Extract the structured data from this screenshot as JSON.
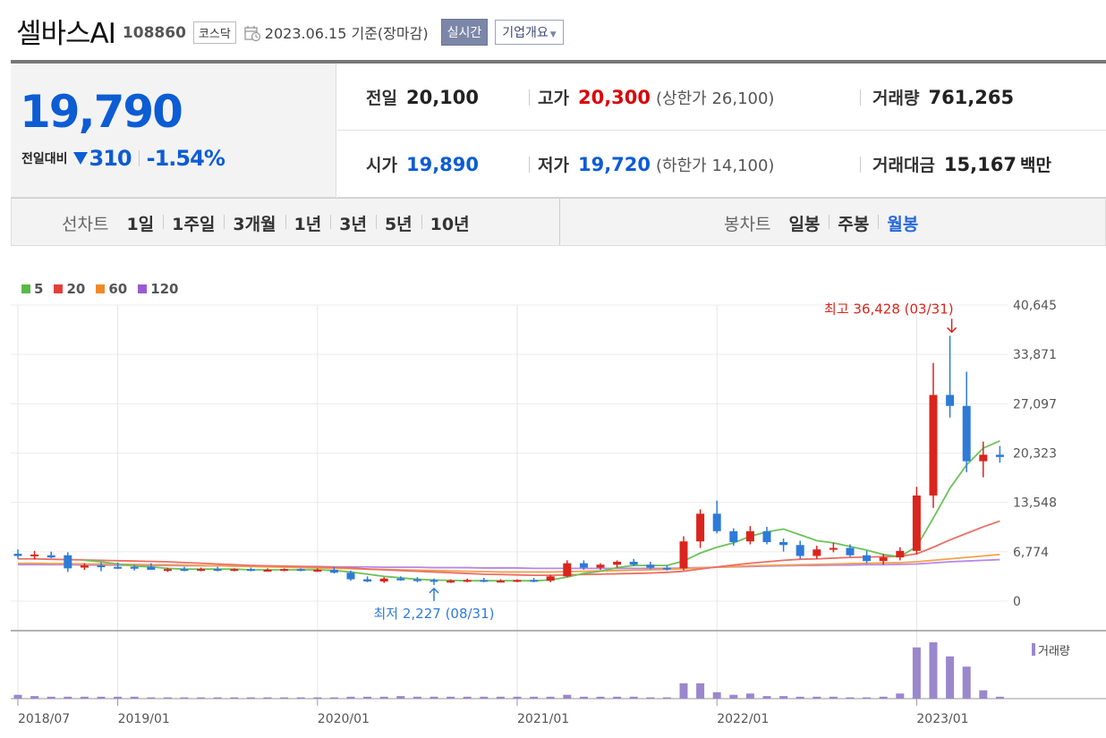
{
  "header": {
    "company_name": "셀바스AI",
    "code": "108860",
    "market": "코스닥",
    "date_text": "2023.06.15 기준(장마감)",
    "realtime_label": "실시간",
    "overview_label": "기업개요"
  },
  "price": {
    "current": "19,790",
    "change_label": "전일대비",
    "change_amount": "310",
    "change_pct": "-1.54%",
    "direction": "down"
  },
  "stats": {
    "prev_close": {
      "label": "전일",
      "value": "20,100"
    },
    "high": {
      "label": "고가",
      "value": "20,300",
      "limit_label": "(상한가 26,100)"
    },
    "volume": {
      "label": "거래량",
      "value": "761,265"
    },
    "open": {
      "label": "시가",
      "value": "19,890"
    },
    "low": {
      "label": "저가",
      "value": "19,720",
      "limit_label": "(하한가 14,100)"
    },
    "trade_value": {
      "label": "거래대금",
      "value": "15,167",
      "unit": "백만"
    }
  },
  "line_chart_tabs": {
    "label": "선차트",
    "items": [
      "1일",
      "1주일",
      "3개월",
      "1년",
      "3년",
      "5년",
      "10년"
    ]
  },
  "candle_chart_tabs": {
    "label": "봉차트",
    "items": [
      "일봉",
      "주봉",
      "월봉"
    ],
    "active": "월봉"
  },
  "legend": [
    {
      "label": "5",
      "color": "#58b847"
    },
    {
      "label": "20",
      "color": "#e0413a"
    },
    {
      "label": "60",
      "color": "#f08a24"
    },
    {
      "label": "120",
      "color": "#9a5bd1"
    }
  ],
  "colors": {
    "up": "#d9251d",
    "down": "#2f7ad8",
    "accent": "#0c5cd4"
  },
  "chart_data": {
    "type": "candlestick",
    "interval": "monthly",
    "y_ticks": [
      0,
      6774,
      13548,
      20323,
      27097,
      33871,
      40645
    ],
    "y_tick_labels": [
      "0",
      "6,774",
      "13,548",
      "20,323",
      "27,097",
      "33,871",
      "40,645"
    ],
    "ylim": [
      0,
      40645
    ],
    "x_tick_labels": [
      "2018/07",
      "2019/01",
      "2020/01",
      "2021/01",
      "2022/01",
      "2023/01"
    ],
    "x_tick_index": [
      0,
      6,
      18,
      30,
      42,
      54
    ],
    "high_annotation": "최고 36,428 (03/31)",
    "low_annotation": "최저 2,227 (08/31)",
    "high_point": {
      "index": 56,
      "value": 36428
    },
    "low_point": {
      "index": 25,
      "value": 2227
    },
    "volume_legend": "거래량",
    "candles": [
      [
        6500,
        7100,
        5800,
        6200
      ],
      [
        6200,
        6900,
        5700,
        6400
      ],
      [
        6300,
        6800,
        5900,
        6000
      ],
      [
        6300,
        6700,
        4000,
        4500
      ],
      [
        4600,
        5200,
        4300,
        4900
      ],
      [
        4900,
        5300,
        4100,
        4700
      ],
      [
        4700,
        5300,
        4400,
        4600
      ],
      [
        4700,
        5000,
        4200,
        4600
      ],
      [
        4700,
        5200,
        4400,
        4300
      ],
      [
        4300,
        4600,
        4000,
        4400
      ],
      [
        4400,
        4700,
        4100,
        4300
      ],
      [
        4300,
        4600,
        4100,
        4400
      ],
      [
        4400,
        4700,
        4100,
        4300
      ],
      [
        4300,
        4500,
        4100,
        4400
      ],
      [
        4400,
        4600,
        4100,
        4300
      ],
      [
        4300,
        4500,
        4100,
        4300
      ],
      [
        4300,
        4500,
        4100,
        4400
      ],
      [
        4400,
        4500,
        4100,
        4300
      ],
      [
        4300,
        4500,
        4000,
        4300
      ],
      [
        4300,
        4700,
        3800,
        3900
      ],
      [
        3900,
        4200,
        2800,
        3000
      ],
      [
        3000,
        3400,
        2600,
        2700
      ],
      [
        2700,
        3300,
        2500,
        3100
      ],
      [
        3100,
        3400,
        2800,
        3000
      ],
      [
        3000,
        3300,
        2600,
        2900
      ],
      [
        2900,
        3100,
        2227,
        2700
      ],
      [
        2700,
        3000,
        2500,
        2800
      ],
      [
        2800,
        3100,
        2600,
        2900
      ],
      [
        2900,
        3200,
        2600,
        2700
      ],
      [
        2700,
        3000,
        2600,
        2800
      ],
      [
        2800,
        3000,
        2600,
        2900
      ],
      [
        2900,
        3200,
        2600,
        2800
      ],
      [
        2800,
        3600,
        2600,
        3400
      ],
      [
        3400,
        5600,
        3300,
        5200
      ],
      [
        5200,
        5600,
        4300,
        4600
      ],
      [
        4600,
        5200,
        4300,
        5000
      ],
      [
        5000,
        5600,
        4600,
        5400
      ],
      [
        5400,
        5800,
        4800,
        5000
      ],
      [
        5000,
        5400,
        4400,
        4600
      ],
      [
        4600,
        4900,
        4200,
        4500
      ],
      [
        4500,
        8900,
        4200,
        8200
      ],
      [
        8200,
        12600,
        7300,
        12000
      ],
      [
        12000,
        13800,
        9300,
        9600
      ],
      [
        9600,
        10000,
        7600,
        8100
      ],
      [
        8200,
        10300,
        7800,
        9600
      ],
      [
        9600,
        10200,
        7800,
        8100
      ],
      [
        8100,
        8600,
        6800,
        7700
      ],
      [
        7700,
        8300,
        5800,
        6200
      ],
      [
        6200,
        7600,
        5800,
        7100
      ],
      [
        7100,
        8000,
        6700,
        7300
      ],
      [
        7300,
        7800,
        6100,
        6300
      ],
      [
        6300,
        6900,
        5200,
        5500
      ],
      [
        5500,
        6500,
        5000,
        6000
      ],
      [
        6000,
        7400,
        5600,
        6900
      ],
      [
        6900,
        15700,
        6400,
        14500
      ],
      [
        14500,
        32700,
        12800,
        28300
      ],
      [
        28300,
        36428,
        25200,
        26800
      ],
      [
        26800,
        31500,
        17700,
        19200
      ],
      [
        19200,
        21900,
        17000,
        20100
      ],
      [
        20100,
        21300,
        19000,
        19790
      ]
    ],
    "ma5": [
      null,
      null,
      null,
      null,
      5600,
      5400,
      5100,
      4800,
      4700,
      4500,
      4400,
      4400,
      4400,
      4400,
      4300,
      4300,
      4300,
      4300,
      4300,
      4200,
      4000,
      3700,
      3400,
      3200,
      3000,
      2900,
      2850,
      2800,
      2800,
      2800,
      2800,
      2800,
      2900,
      3300,
      3800,
      4100,
      4600,
      4900,
      4900,
      4900,
      5500,
      6600,
      7400,
      8000,
      8900,
      9500,
      9900,
      9100,
      8300,
      8000,
      7500,
      7000,
      6400,
      6100,
      7500,
      11400,
      15500,
      18700,
      21000,
      22000
    ],
    "ma20": [
      5800,
      5800,
      5750,
      5700,
      5650,
      5600,
      5550,
      5500,
      5450,
      5400,
      5300,
      5200,
      5100,
      5000,
      4900,
      4850,
      4800,
      4750,
      4700,
      4650,
      4550,
      4400,
      4300,
      4200,
      4100,
      4000,
      3900,
      3800,
      3700,
      3650,
      3600,
      3550,
      3550,
      3600,
      3650,
      3700,
      3750,
      3800,
      3850,
      3950,
      4100,
      4400,
      4700,
      4950,
      5200,
      5400,
      5600,
      5750,
      5800,
      5900,
      6000,
      6050,
      6100,
      6150,
      6500,
      7400,
      8400,
      9300,
      10200,
      11000
    ],
    "ma60": [
      5200,
      5200,
      5150,
      5150,
      5100,
      5100,
      5050,
      5050,
      5000,
      5000,
      4950,
      4900,
      4850,
      4800,
      4750,
      4700,
      4650,
      4600,
      4550,
      4500,
      4450,
      4400,
      4350,
      4300,
      4250,
      4200,
      4150,
      4100,
      4050,
      4000,
      4000,
      4000,
      4000,
      4050,
      4100,
      4150,
      4200,
      4250,
      4300,
      4350,
      4450,
      4550,
      4650,
      4750,
      4850,
      4900,
      4950,
      5000,
      5050,
      5100,
      5150,
      5200,
      5250,
      5300,
      5400,
      5600,
      5800,
      6000,
      6200,
      6400
    ],
    "ma120": [
      5000,
      5000,
      5000,
      5000,
      4950,
      4950,
      4950,
      4900,
      4900,
      4900,
      4850,
      4850,
      4850,
      4800,
      4800,
      4800,
      4750,
      4750,
      4750,
      4700,
      4700,
      4700,
      4650,
      4650,
      4650,
      4600,
      4600,
      4600,
      4550,
      4550,
      4550,
      4500,
      4500,
      4500,
      4500,
      4500,
      4500,
      4500,
      4500,
      4500,
      4550,
      4600,
      4650,
      4700,
      4750,
      4800,
      4850,
      4900,
      4900,
      4950,
      4950,
      5000,
      5000,
      5050,
      5100,
      5250,
      5400,
      5500,
      5600,
      5700
    ],
    "volume": [
      6,
      4,
      3,
      3,
      3,
      3,
      3,
      3,
      2,
      2,
      2,
      2,
      2,
      2,
      2,
      2,
      2,
      2,
      2,
      2,
      3,
      3,
      3,
      4,
      3,
      3,
      3,
      3,
      3,
      3,
      3,
      3,
      3,
      6,
      3,
      3,
      3,
      3,
      2,
      2,
      24,
      24,
      10,
      6,
      8,
      4,
      4,
      3,
      3,
      3,
      2,
      2,
      3,
      8,
      80,
      88,
      66,
      50,
      13,
      3
    ]
  }
}
